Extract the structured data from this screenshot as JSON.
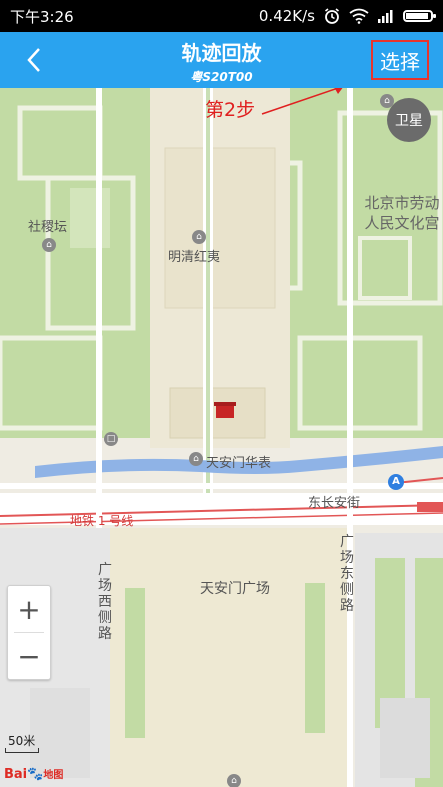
{
  "status_bar": {
    "time": "下午3:26",
    "network_speed": "0.42K/s",
    "icons": [
      "alarm-icon",
      "wifi-icon",
      "signal-icon",
      "battery-icon"
    ]
  },
  "header": {
    "title": "轨迹回放",
    "subtitle": "粤S20T00",
    "select_label": "选择",
    "back_icon": "chevron-left-icon"
  },
  "annotation": {
    "step_label": "第2步"
  },
  "map": {
    "satellite_label": "卫星",
    "places": {
      "sheji_tan": "社稷坛",
      "mingqing_hongyi": "明清红夷",
      "beijing_labor_line1": "北京市劳动",
      "beijing_labor_line2": "人民文化宫",
      "tiananmen_huabiao": "天安门华表",
      "dongchang_an_street": "东长安街",
      "metro_line": "地铁 1 号线",
      "tiananmen_square": "天安门广场",
      "square_west_road": "广场西侧路",
      "square_east_road": "广场东侧路"
    },
    "marker_label": "A",
    "zoom_in": "+",
    "zoom_out": "−",
    "scale": "50米",
    "logo_bai": "Bai",
    "logo_paw": "🐾",
    "logo_map": "地图"
  },
  "colors": {
    "header_bg": "#2aa3ef",
    "annotation": "#e02020",
    "park_green": "#c2dba4",
    "river": "#8fb3e6",
    "metro": "#e25656"
  }
}
